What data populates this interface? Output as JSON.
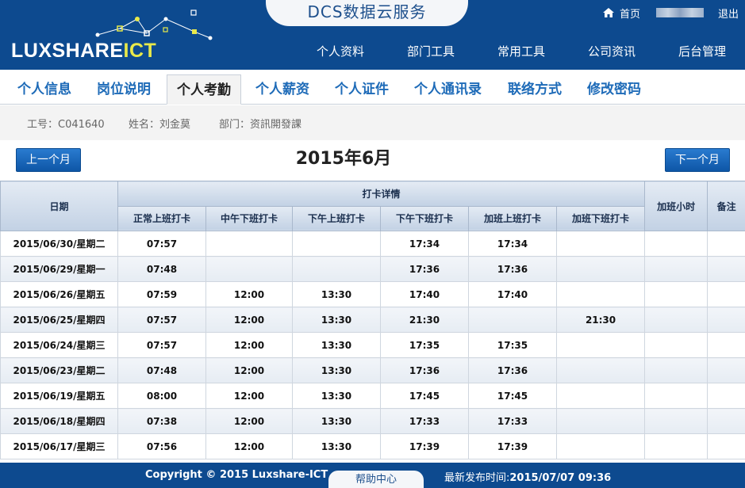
{
  "header": {
    "site_title": "DCS数据云服务",
    "logo_main": "LUXSHARE",
    "logo_accent": "ICT",
    "home_label": "首页",
    "logout_label": "退出",
    "nav": [
      "个人资料",
      "部门工具",
      "常用工具",
      "公司资讯",
      "后台管理"
    ]
  },
  "subnav": {
    "tabs": [
      "个人信息",
      "岗位说明",
      "个人考勤",
      "个人薪资",
      "个人证件",
      "个人通讯录",
      "联络方式",
      "修改密码"
    ],
    "active": "个人考勤"
  },
  "info": {
    "employee_id": "工号：C041640",
    "name": "姓名：刘金莫",
    "department": "部门：资訊開發課"
  },
  "calendar": {
    "prev_label": "上一个月",
    "next_label": "下一个月",
    "month_title": "2015年6月"
  },
  "table": {
    "col_date": "日期",
    "group_header": "打卡详情",
    "col_overtime_hours": "加班小时",
    "col_note": "备注",
    "sub_headers": [
      "正常上班打卡",
      "中午下班打卡",
      "下午上班打卡",
      "下午下班打卡",
      "加班上班打卡",
      "加班下班打卡"
    ],
    "rows": [
      [
        "2015/06/30/星期二",
        "07:57",
        "",
        "",
        "17:34",
        "17:34",
        "",
        "",
        ""
      ],
      [
        "2015/06/29/星期一",
        "07:48",
        "",
        "",
        "17:36",
        "17:36",
        "",
        "",
        ""
      ],
      [
        "2015/06/26/星期五",
        "07:59",
        "12:00",
        "13:30",
        "17:40",
        "17:40",
        "",
        "",
        ""
      ],
      [
        "2015/06/25/星期四",
        "07:57",
        "12:00",
        "13:30",
        "21:30",
        "",
        "21:30",
        "",
        ""
      ],
      [
        "2015/06/24/星期三",
        "07:57",
        "12:00",
        "13:30",
        "17:35",
        "17:35",
        "",
        "",
        ""
      ],
      [
        "2015/06/23/星期二",
        "07:48",
        "12:00",
        "13:30",
        "17:36",
        "17:36",
        "",
        "",
        ""
      ],
      [
        "2015/06/19/星期五",
        "08:00",
        "12:00",
        "13:30",
        "17:45",
        "17:45",
        "",
        "",
        ""
      ],
      [
        "2015/06/18/星期四",
        "07:38",
        "12:00",
        "13:30",
        "17:33",
        "17:33",
        "",
        "",
        ""
      ],
      [
        "2015/06/17/星期三",
        "07:56",
        "12:00",
        "13:30",
        "17:39",
        "17:39",
        "",
        "",
        ""
      ]
    ]
  },
  "footer": {
    "copyright": "Copyright © 2015 Luxshare-ICT",
    "help": "帮助中心",
    "release_label": "最新发布时间:",
    "release_time": "2015/07/07 09:36"
  },
  "colors": {
    "brand": "#0d4a8f",
    "tab_text": "#1e6bb8",
    "logo_accent": "#e8e94a"
  }
}
